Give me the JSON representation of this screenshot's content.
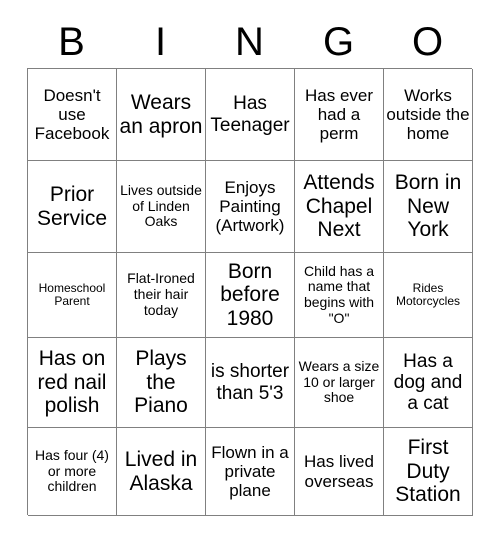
{
  "card": {
    "title": "BINGO",
    "header_letters": [
      "B",
      "I",
      "N",
      "G",
      "O"
    ],
    "grid_line_color": "#808080",
    "text_color": "#000000",
    "background_color": "#ffffff",
    "columns": 5,
    "rows": 5,
    "cells": [
      {
        "text": "Doesn't use Facebook",
        "size": "fs-md"
      },
      {
        "text": "Wears an apron",
        "size": "fs-xl"
      },
      {
        "text": "Has Teenager",
        "size": "fs-lg"
      },
      {
        "text": "Has ever had a perm",
        "size": "fs-md"
      },
      {
        "text": "Works outside the home",
        "size": "fs-md"
      },
      {
        "text": "Prior Service",
        "size": "fs-xl"
      },
      {
        "text": "Lives outside of Linden Oaks",
        "size": "fs-sm"
      },
      {
        "text": "Enjoys Painting (Artwork)",
        "size": "fs-md"
      },
      {
        "text": "Attends Chapel Next",
        "size": "fs-xl"
      },
      {
        "text": "Born in New York",
        "size": "fs-xl"
      },
      {
        "text": "Homeschool Parent",
        "size": "fs-xs"
      },
      {
        "text": "Flat-Ironed their hair today",
        "size": "fs-sm"
      },
      {
        "text": "Born before 1980",
        "size": "fs-xl"
      },
      {
        "text": "Child has a name that begins with \"O\"",
        "size": "fs-sm"
      },
      {
        "text": "Rides Motorcycles",
        "size": "fs-xs"
      },
      {
        "text": "Has on red nail polish",
        "size": "fs-xl"
      },
      {
        "text": "Plays the Piano",
        "size": "fs-xl"
      },
      {
        "text": "is shorter than 5'3",
        "size": "fs-lg"
      },
      {
        "text": "Wears a size 10 or larger shoe",
        "size": "fs-sm"
      },
      {
        "text": "Has a dog and a cat",
        "size": "fs-lg"
      },
      {
        "text": "Has four (4) or more children",
        "size": "fs-sm"
      },
      {
        "text": "Lived in Alaska",
        "size": "fs-xl"
      },
      {
        "text": "Flown in a private plane",
        "size": "fs-md"
      },
      {
        "text": "Has lived overseas",
        "size": "fs-md"
      },
      {
        "text": "First Duty Station",
        "size": "fs-xl"
      }
    ]
  }
}
